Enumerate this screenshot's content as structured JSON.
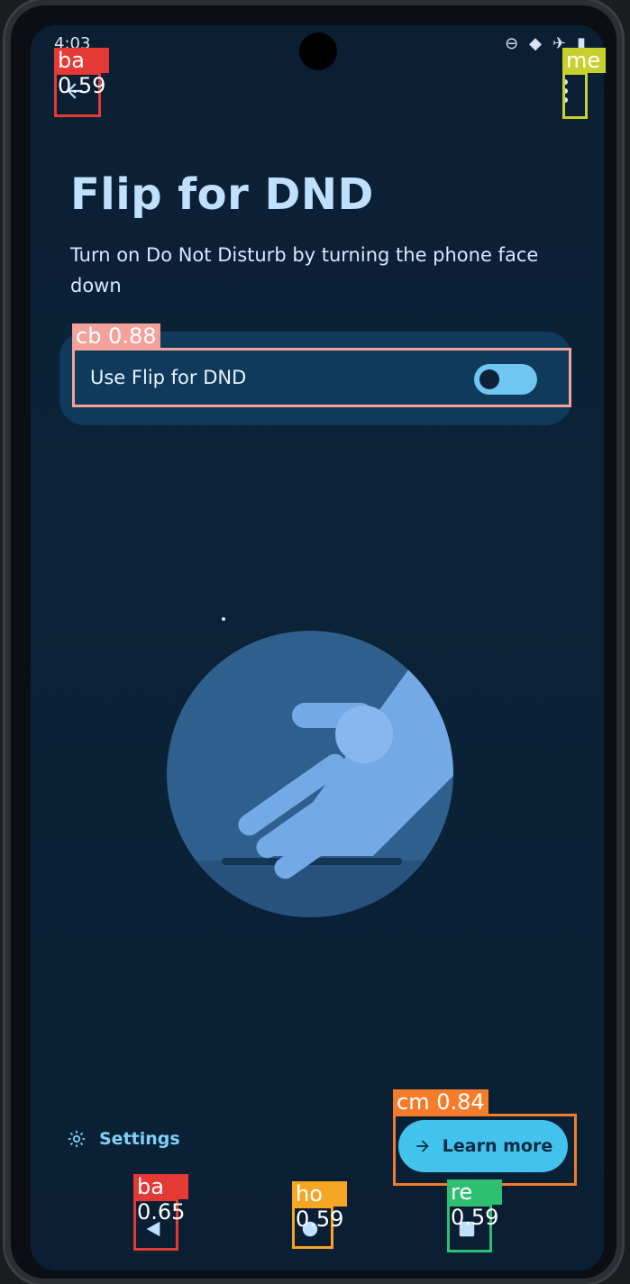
{
  "status": {
    "time": "4:03",
    "icons": [
      "dnd-icon",
      "wifi-icon",
      "airplane-icon",
      "battery-icon"
    ]
  },
  "header": {
    "back_icon": "arrow-left-icon",
    "more_icon": "more-vert-icon"
  },
  "page": {
    "title": "Flip for DND",
    "subtitle": "Turn on Do Not Disturb by turning the phone face down"
  },
  "toggle": {
    "label": "Use Flip for DND",
    "state": "off"
  },
  "footer": {
    "settings_label": "Settings",
    "learn_more_label": "Learn more"
  },
  "nav": {
    "back": "triangle-back-icon",
    "home": "circle-home-icon",
    "recents": "square-recents-icon"
  },
  "annotations": [
    {
      "label": "ba 0.59"
    },
    {
      "label": "me 0"
    },
    {
      "label": "cb 0.88"
    },
    {
      "label": "cm 0.84"
    },
    {
      "label": "ba 0.65"
    },
    {
      "label": "ho 0.59"
    },
    {
      "label": "re 0.59"
    }
  ],
  "colors": {
    "accent": "#42c3ee",
    "title": "#bfe0ff",
    "card": "#0f3a5b"
  }
}
